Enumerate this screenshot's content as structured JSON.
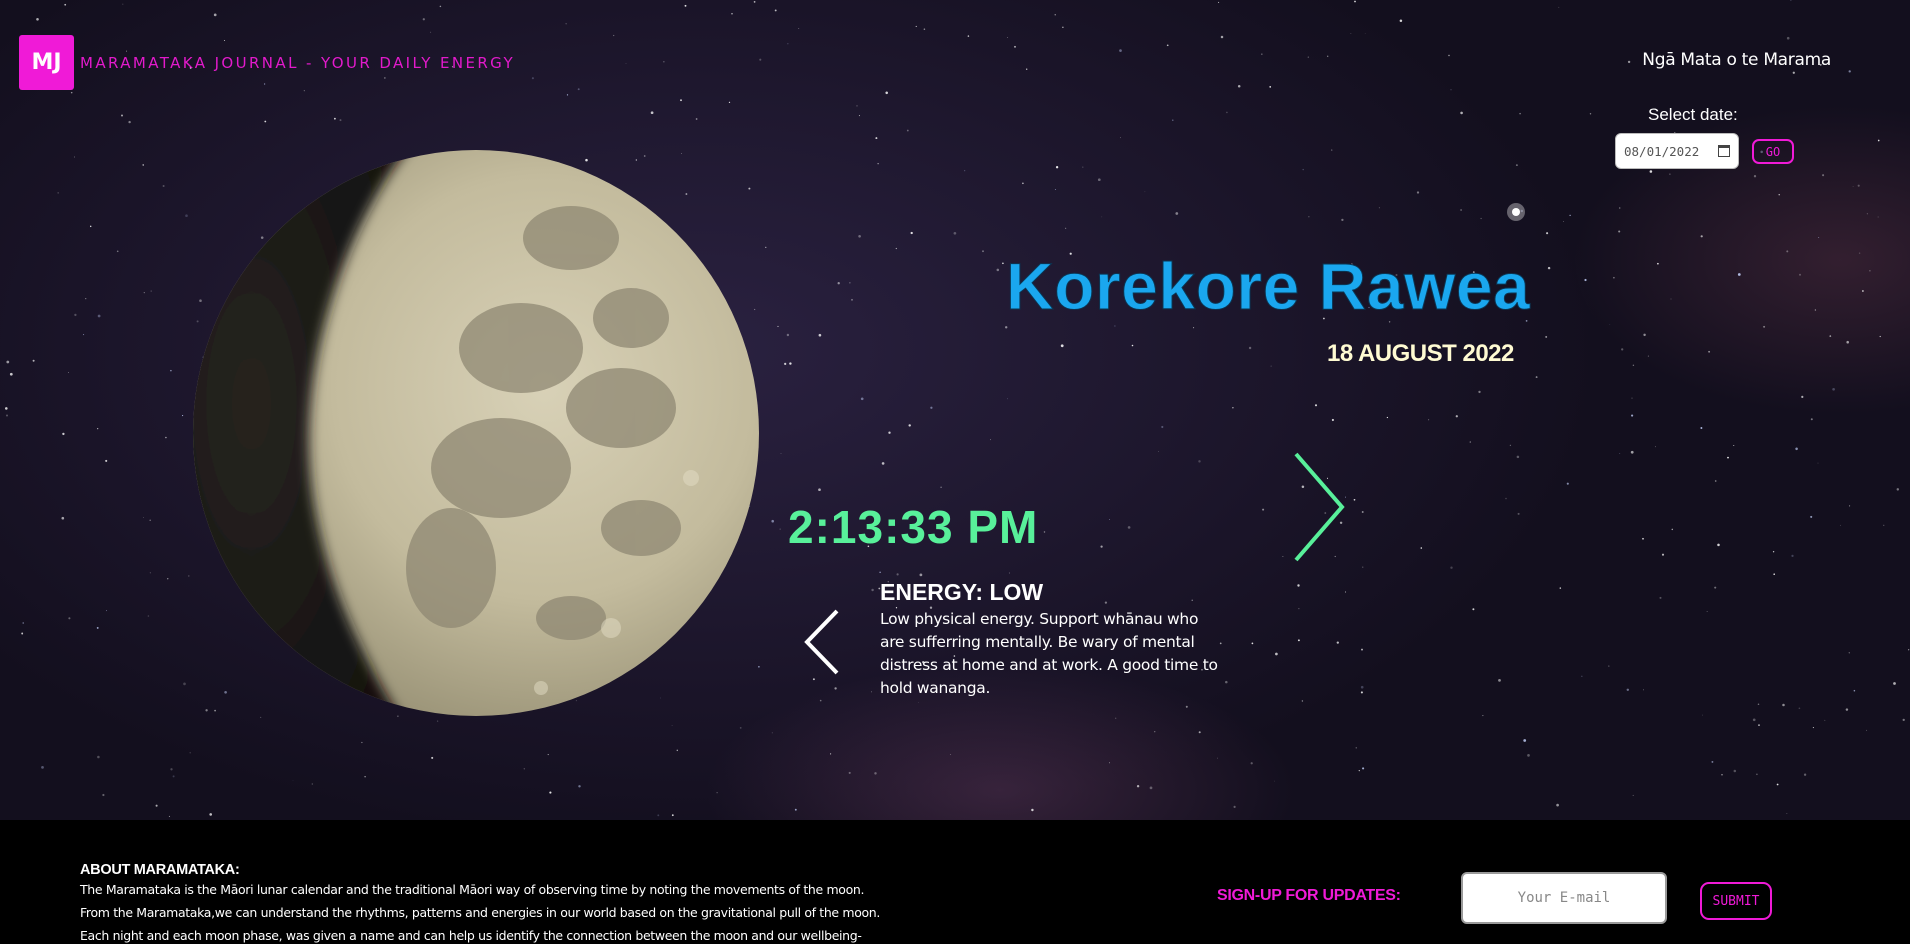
{
  "header": {
    "logo": "MJ",
    "title": "MARAMATAKA JOURNAL - YOUR DAILY ENERGY",
    "nav_link": "Ngā Mata o te Marama"
  },
  "date_picker": {
    "label": "Select date:",
    "value": "08/01/2022",
    "go_label": "GO"
  },
  "phase": {
    "name": "Korekore Rawea",
    "date": "18 AUGUST 2022",
    "time": "2:13:33 PM"
  },
  "energy": {
    "title": "ENERGY: LOW",
    "description": "Low physical energy. Support whānau who are sufferring mentally. Be wary of mental distress at home and at work. A good time to hold wananga."
  },
  "footer": {
    "about_title": "ABOUT MARAMATAKA:",
    "about_lines": [
      "The Maramataka is the Māori lunar calendar and the traditional Māori way of observing time by noting the movements of the moon.",
      "From the Maramataka,we can understand the rhythms, patterns and energies in our world based on the gravitational pull of the moon.",
      "Each night and each moon phase, was given a name and can help us identify the connection between the moon and our wellbeing-"
    ],
    "signup_label": "SIGN-UP FOR UPDATES:",
    "email_placeholder": "Your E-mail",
    "submit_label": "SUBMIT"
  },
  "icons": {
    "next": "chevron-right-icon",
    "prev": "chevron-left-icon",
    "calendar": "calendar-icon"
  },
  "colors": {
    "accent": "#f01ad7",
    "phase_name": "#1aa7ef",
    "clock": "#58f09a",
    "phase_date": "#fffbd2",
    "footer_bg": "#000000"
  }
}
